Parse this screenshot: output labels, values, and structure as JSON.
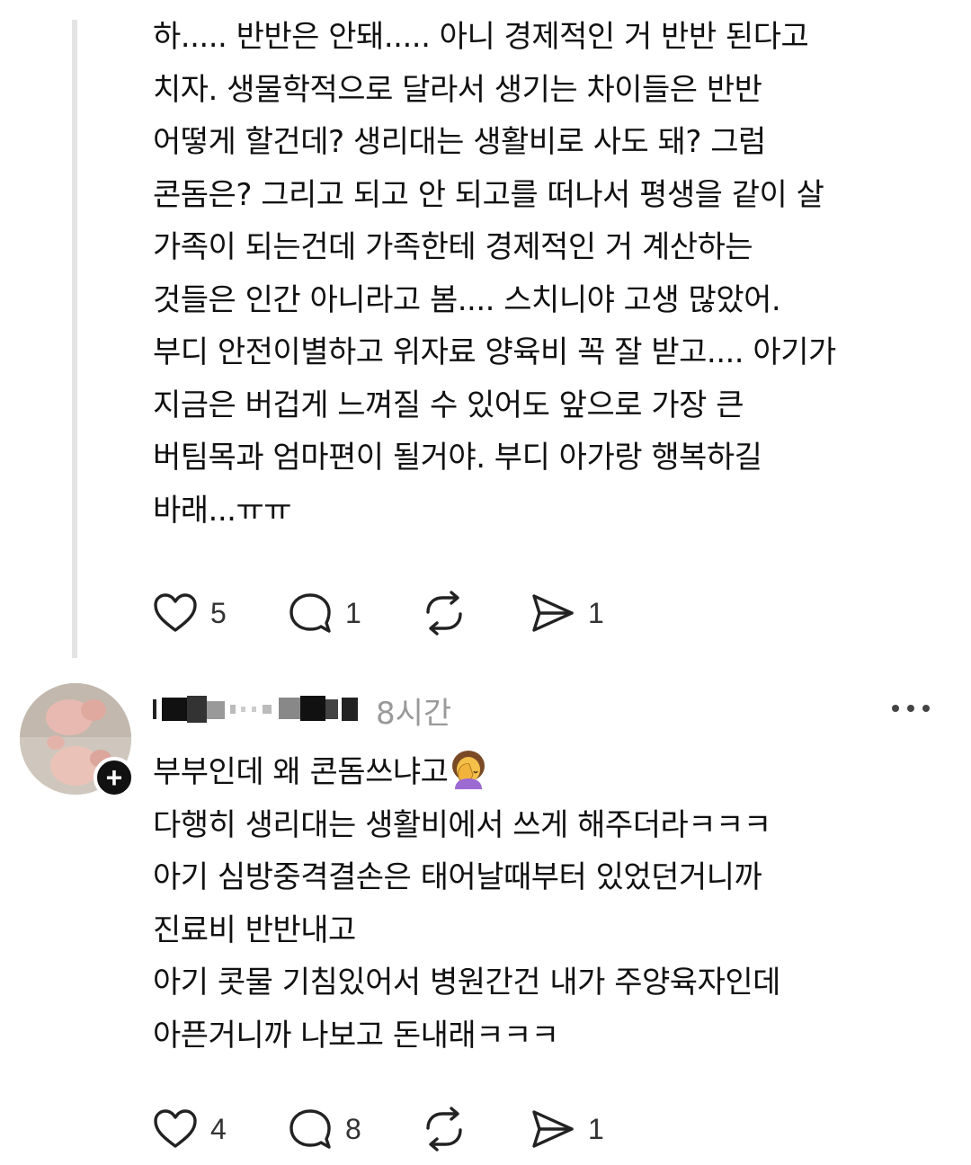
{
  "post1": {
    "lines": [
      "하..... 반반은 안돼..... 아니 경제적인 거 반반 된다고",
      "치자. 생물학적으로 달라서 생기는 차이들은 반반",
      "어떻게 할건데? 생리대는 생활비로 사도 돼? 그럼",
      "콘돔은? 그리고 되고 안 되고를 떠나서 평생을 같이 살",
      "가족이 되는건데 가족한테 경제적인 거 계산하는",
      "것들은 인간 아니라고 봄.... 스치니야 고생 많았어.",
      "부디 안전이별하고 위자료 양육비 꼭 잘 받고.... 아기가",
      "지금은 버겁게 느껴질 수 있어도 앞으로 가장 큰",
      "버팀목과 엄마편이 될거야. 부디 아가랑 행복하길",
      "바래...ㅠㅠ"
    ],
    "actions": {
      "likes": "5",
      "replies": "1",
      "reposts": "",
      "shares": "1"
    }
  },
  "post2": {
    "timestamp": "8시간",
    "emoji": "face-palm-emoji",
    "lines": [
      "부부인데 왜 콘돔쓰냐고",
      "다행히 생리대는 생활비에서 쓰게 해주더라ㅋㅋㅋ",
      "아기 심방중격결손은 태어날때부터 있었던거니까",
      "진료비 반반내고",
      "아기 콧물 기침있어서 병원간건 내가 주양육자인데",
      "아픈거니까 나보고 돈내래ㅋㅋㅋ"
    ],
    "actions": {
      "likes": "4",
      "replies": "8",
      "reposts": "",
      "shares": "1"
    }
  },
  "icons": {
    "like": "heart-icon",
    "reply": "speech-bubble-icon",
    "repost": "repost-arrows-icon",
    "share": "send-arrow-icon",
    "more": "more-dots-icon",
    "follow": "plus-icon"
  },
  "follow_label": "+"
}
